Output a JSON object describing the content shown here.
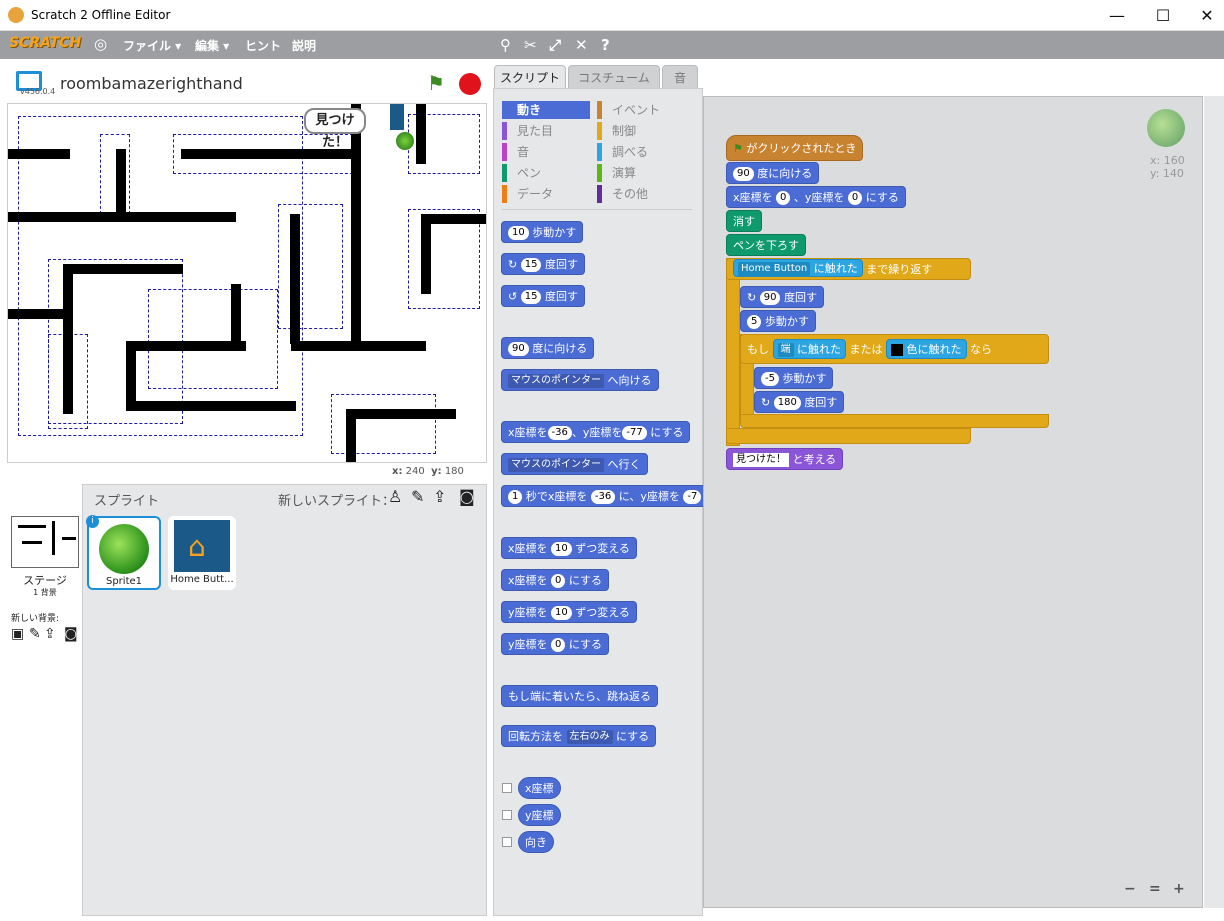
{
  "window": {
    "title": "Scratch 2 Offline Editor",
    "minimize": "—",
    "maximize": "☐",
    "close": "✕"
  },
  "menubar": {
    "logo": "SCRATCH",
    "items": [
      "ファイル ▾",
      "編集 ▾",
      "ヒント",
      "説明"
    ]
  },
  "stage": {
    "project_name": "roombamazerighthand",
    "version": "v456.0.4",
    "speech": "見つけた！",
    "coord_x_label": "x:",
    "coord_x": "240",
    "coord_y_label": "y:",
    "coord_y": "180"
  },
  "sprites": {
    "title": "スプライト",
    "new_sprite": "新しいスプライト：",
    "list": [
      {
        "name": "Sprite1"
      },
      {
        "name": "Home Butt..."
      }
    ],
    "stage_label": "ステージ",
    "stage_sub": "1 背景",
    "new_backdrop": "新しい背景:"
  },
  "tabs": [
    "スクリプト",
    "コスチューム",
    "音"
  ],
  "categories": [
    [
      "動き",
      "イベント"
    ],
    [
      "見た目",
      "制御"
    ],
    [
      "音",
      "調べる"
    ],
    [
      "ペン",
      "演算"
    ],
    [
      "データ",
      "その他"
    ]
  ],
  "category_colors": [
    [
      "#4a6cd4",
      "#c88330"
    ],
    [
      "#8a55d7",
      "#e1a91a"
    ],
    [
      "#bb42c3",
      "#2ca5e2"
    ],
    [
      "#0e9a6c",
      "#5cb712"
    ],
    [
      "#ee7d16",
      "#632d99"
    ]
  ],
  "palette": {
    "move": [
      "10",
      "歩動かす"
    ],
    "turn_r": [
      "15",
      "度回す"
    ],
    "turn_l": [
      "15",
      "度回す"
    ],
    "point": [
      "90",
      "度に向ける"
    ],
    "point_to": [
      "マウスのポインター",
      "へ向ける"
    ],
    "goto_xy": [
      "x座標を",
      "-36",
      "、y座標を",
      "-77",
      "にする"
    ],
    "goto": [
      "マウスのポインター",
      "へ行く"
    ],
    "glide": [
      "1",
      "秒でx座標を",
      "-36",
      "に、y座標を",
      "-7"
    ],
    "change_x": [
      "x座標を",
      "10",
      "ずつ変える"
    ],
    "set_x": [
      "x座標を",
      "0",
      "にする"
    ],
    "change_y": [
      "y座標を",
      "10",
      "ずつ変える"
    ],
    "set_y": [
      "y座標を",
      "0",
      "にする"
    ],
    "bounce": "もし端に着いたら、跳ね返る",
    "rotation": [
      "回転方法を",
      "左右のみ",
      "にする"
    ],
    "reporters": [
      "x座標",
      "y座標",
      "向き"
    ]
  },
  "script": {
    "hat": "がクリックされたとき",
    "point": [
      "90",
      "度に向ける"
    ],
    "goto": [
      "x座標を",
      "0",
      "、y座標を",
      "0",
      "にする"
    ],
    "clear": "消す",
    "pendown": "ペンを下ろす",
    "repeat_until": [
      "Home Button",
      "に触れた",
      "まで繰り返す"
    ],
    "turn": [
      "90",
      "度回す"
    ],
    "move": [
      "5",
      "歩動かす"
    ],
    "if": [
      "もし",
      "端",
      "に触れた",
      "または",
      "色に触れた",
      "なら"
    ],
    "move2": [
      "-5",
      "歩動かす"
    ],
    "turn2": [
      "180",
      "度回す"
    ],
    "think": [
      "見つけた！",
      "と考える"
    ],
    "sprite_x": "x: 160",
    "sprite_y": "y: 140"
  },
  "zoom": [
    "−",
    "=",
    "+"
  ]
}
